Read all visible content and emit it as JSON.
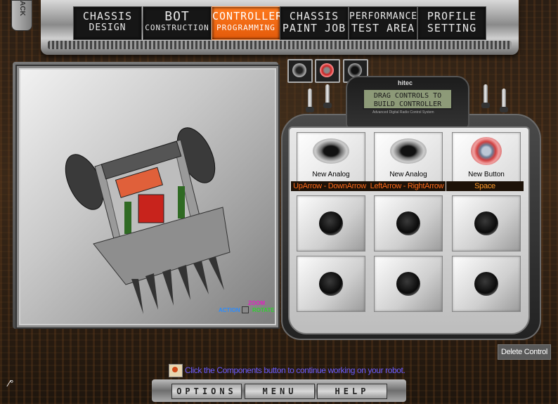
{
  "back_tab": {
    "label": "ACK"
  },
  "nav_tabs": [
    {
      "line1": "CHASSIS",
      "line2": "DESIGN",
      "active": false
    },
    {
      "line1": "BOT",
      "line2": "CONSTRUCTION",
      "active": false
    },
    {
      "line1": "CONTROLLER",
      "line2": "PROGRAMMING",
      "active": true
    },
    {
      "line1": "CHASSIS",
      "line2": "PAINT JOB",
      "active": false
    },
    {
      "line1": "PERFORMANCE",
      "line2": "TEST AREA",
      "active": false
    },
    {
      "line1": "PROFILE",
      "line2": "SETTING",
      "active": false
    }
  ],
  "viewport": {
    "legend": {
      "zoom": "ZOOM",
      "action": "ACTION",
      "rotate": "ROTATE"
    }
  },
  "controller": {
    "brand": "hitec",
    "lcd_line1": "DRAG CONTROLS TO",
    "lcd_line2": "BUILD  CONTROLLER",
    "lcd_subtitle": "Advanced Digital Radio Control System",
    "component_buttons": [
      "analog-stick-icon",
      "red-button-icon",
      "joystick-knob-icon"
    ],
    "slots": [
      {
        "name": "New Analog",
        "key": "UpArrow - DownArrow",
        "type": "analog"
      },
      {
        "name": "New Analog",
        "key": "LeftArrow - RightArrow",
        "type": "analog"
      },
      {
        "name": "New Button",
        "key": "Space",
        "type": "button"
      }
    ]
  },
  "delete_control": {
    "label": "Delete Control"
  },
  "hint": {
    "text": "Click the Components button to continue working on your robot."
  },
  "bottom_menu": {
    "options": "OPTIONS",
    "menu": "MENU",
    "help": "HELP"
  },
  "colors": {
    "active_tab": "#ff6a1a",
    "key_text": "#ff6a1a",
    "hint_text": "#6a5cff"
  }
}
